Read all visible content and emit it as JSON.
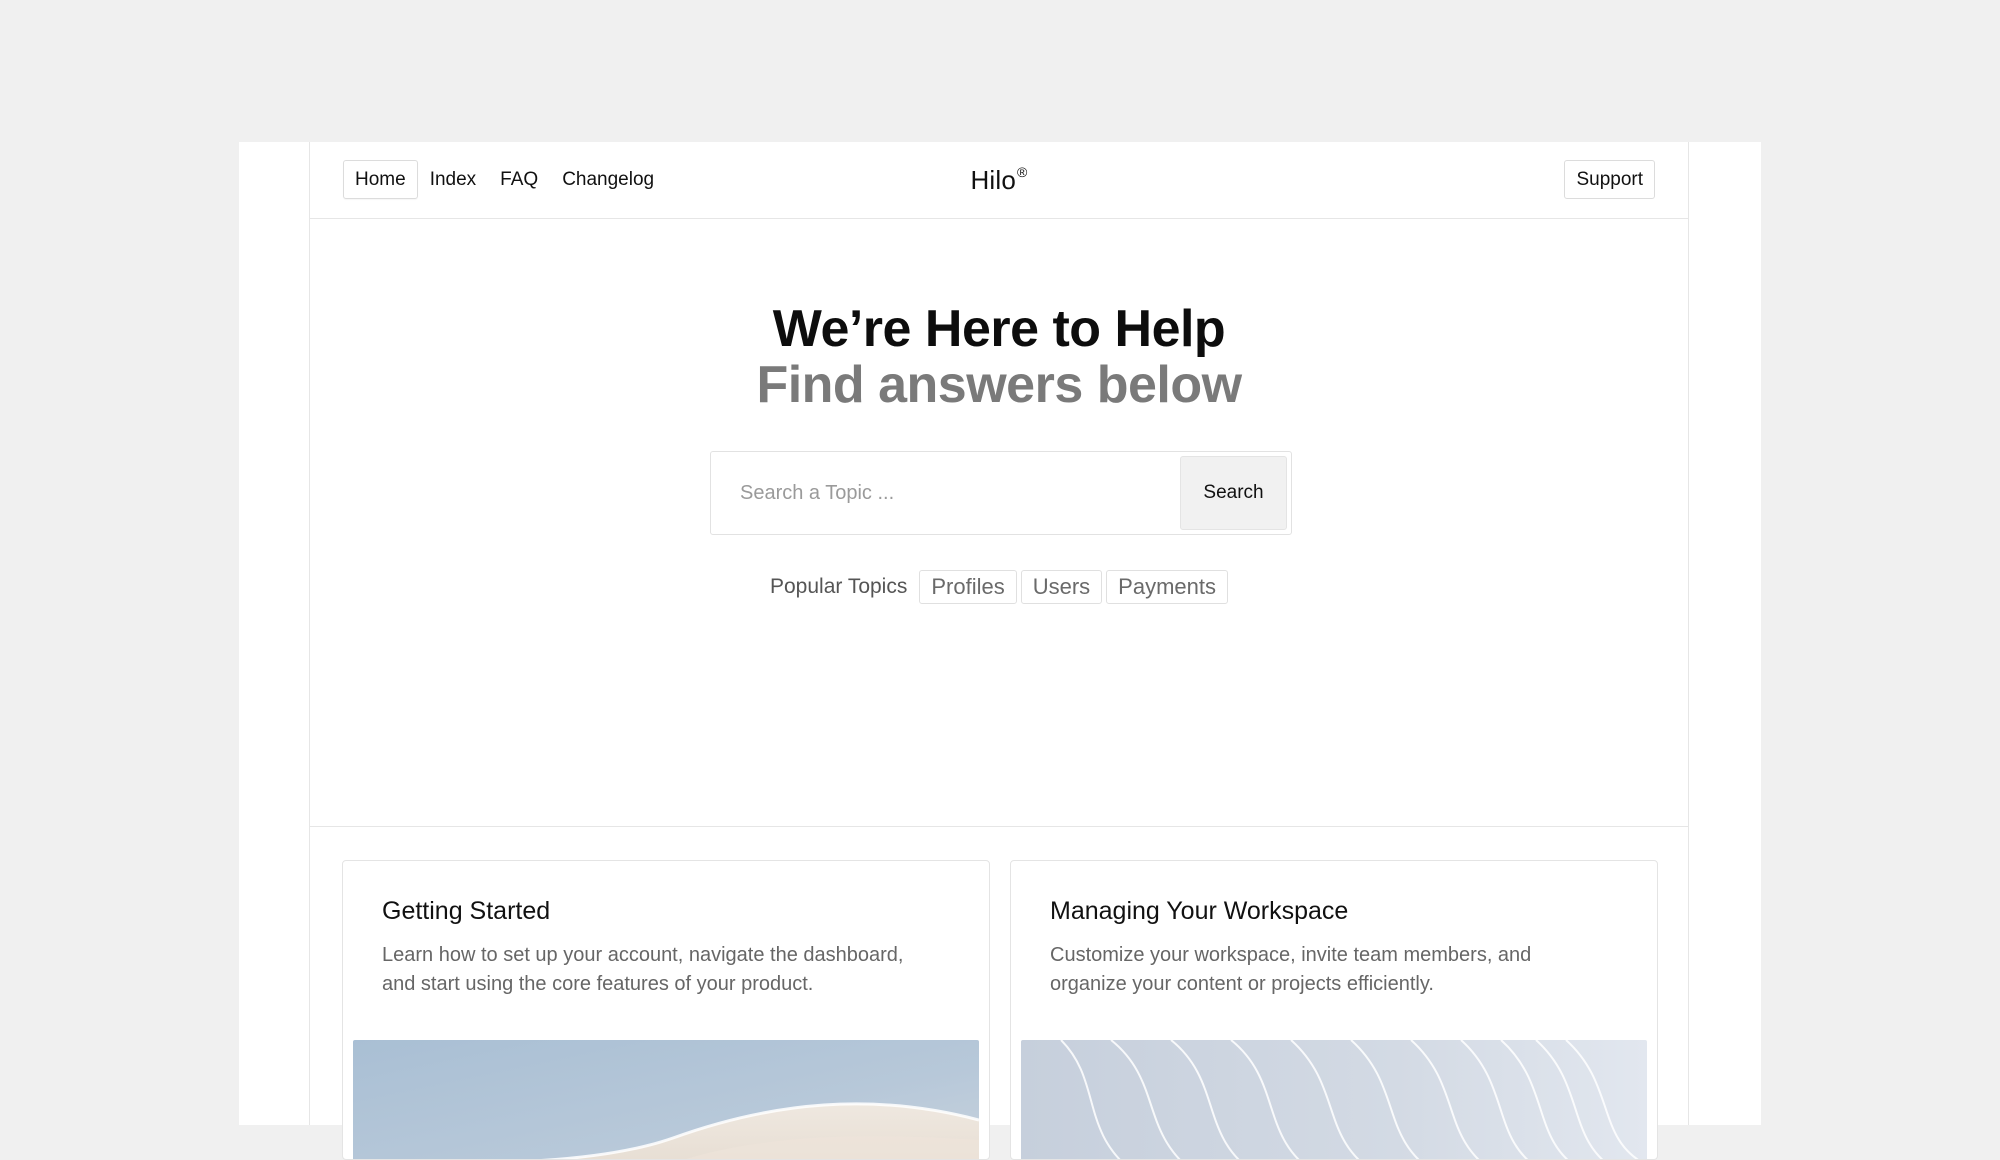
{
  "nav": {
    "links": [
      {
        "label": "Home",
        "active": true
      },
      {
        "label": "Index",
        "active": false
      },
      {
        "label": "FAQ",
        "active": false
      },
      {
        "label": "Changelog",
        "active": false
      }
    ],
    "brand": "Hilo",
    "brand_mark": "®",
    "support_label": "Support"
  },
  "hero": {
    "title": "We’re Here to Help",
    "subtitle": "Find answers below"
  },
  "search": {
    "placeholder": "Search a Topic ...",
    "value": "",
    "button_label": "Search"
  },
  "popular": {
    "label": "Popular Topics",
    "topics": [
      "Profiles",
      "Users",
      "Payments"
    ]
  },
  "cards": [
    {
      "title": "Getting Started",
      "description": "Learn how to set up your account, navigate the dashboard, and start using the core features of your product.",
      "image": "sand-dune-image"
    },
    {
      "title": "Managing Your Workspace",
      "description": "Customize your workspace, invite team members, and organize your content or projects efficiently.",
      "image": "abstract-waves-image"
    }
  ],
  "colors": {
    "page_background": "#f0f0f0",
    "panel_background": "#ffffff",
    "border": "#e6e6e6",
    "muted_text": "#7a7a7a",
    "search_button_bg": "#f1f1f1"
  }
}
